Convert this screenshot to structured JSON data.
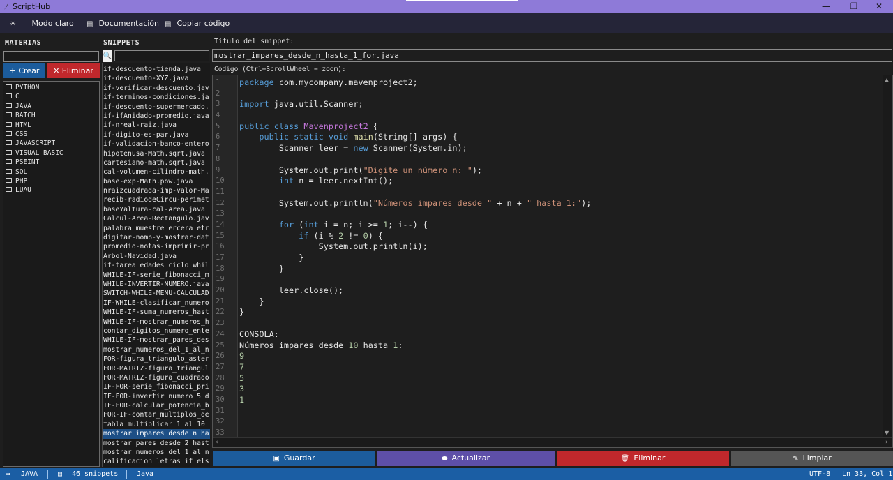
{
  "window": {
    "title": "ScriptHub",
    "controls": [
      "—",
      "❐",
      "✕"
    ]
  },
  "menu": [
    {
      "icon": "☀",
      "label": "Modo claro"
    },
    {
      "icon": "▤",
      "label": "Documentación"
    },
    {
      "icon": "▤",
      "label": "Copiar código"
    }
  ],
  "materias": {
    "title": "MATERIAS",
    "create_label": "+ Crear",
    "delete_label": "✕ Eliminar",
    "items": [
      "PYTHON",
      "C",
      "JAVA",
      "BATCH",
      "HTML",
      "CSS",
      "JAVASCRIPT",
      "VISUAL BASIC",
      "PSEINT",
      "SQL",
      "PHP",
      "LUAU"
    ]
  },
  "snippets": {
    "title": "SNIPPETS",
    "search_icon": "🔍",
    "selected_index": 39,
    "items": [
      "if-descuento-tienda.java",
      "if-descuento-XYZ.java",
      "if-verificar-descuento.jav",
      "if-terminos-condiciones.ja",
      "if-descuento-supermercado.",
      "if-ifAnidado-promedio.java",
      "if-nreal-raiz.java",
      "if-digito-es-par.java",
      "if-validacion-banco-entero",
      "hipotenusa-Math.sqrt.java",
      "cartesiano-math.sqrt.java",
      "cal-volumen-cilindro-math.",
      "base-exp-Math.pow.java",
      "nraizcuadrada-imp-valor-Ma",
      "recib-radiodeCircu-perimet",
      "baseYaltura-cal-Area.java",
      "Calcul-Area-Rectangulo.jav",
      "palabra_muestre_ercera_etr",
      "digitar-nomb-y-mostrar-dat",
      "promedio-notas-imprimir-pr",
      "Arbol-Navidad.java",
      "if-tarea_edades_ciclo_whil",
      "WHILE-IF-serie_fibonacci_m",
      "WHILE-INVERTIR-NUMERO.java",
      "SWITCH-WHILE-MENU-CALCULAD",
      "IF-WHILE-clasificar_numero",
      "WHILE-IF-suma_numeros_hast",
      "WHILE-IF-mostrar_numeros_h",
      "contar_digitos_numero_ente",
      "WHILE-IF-mostrar_pares_des",
      "mostrar_numeros_del_1_al_n",
      "FOR-figura_triangulo_aster",
      "FOR-MATRIZ-figura_triangul",
      "FOR-MATRIZ-figura_cuadrado",
      "IF-FOR-serie_fibonacci_pri",
      "IF-FOR-invertir_numero_5_d",
      "IF-FOR-calcular_potencia_b",
      "FOR-IF-contar_multiplos_de",
      "tabla_multiplicar_1_al_10_",
      "mostrar_impares_desde_n_ha",
      "mostrar_pares_desde_2_hast",
      "mostrar_numeros_del_1_al_n",
      "calificacion_letras_if_els"
    ]
  },
  "editor": {
    "title_label": "Título del snippet:",
    "title_value": "mostrar_impares_desde_n_hasta_1_for.java",
    "code_label": "Código  (Ctrl+ScrollWheel = zoom):",
    "line_numbers": [
      "1",
      "2",
      "3",
      "4",
      "5",
      "6",
      "7",
      "8",
      "9",
      "10",
      "11",
      "12",
      "13",
      "14",
      "15",
      "16",
      "17",
      "18",
      "19",
      "20",
      "21",
      "22",
      "23",
      "24",
      "25",
      "26",
      "27",
      "28",
      "29",
      "30",
      "31",
      "32",
      "33"
    ],
    "code": {
      "l1_kw": "package",
      "l1_rest": " com.mycompany.mavenproject2;",
      "l3_kw": "import",
      "l3_rest": " java.util.Scanner;",
      "l5_kw1": "public",
      "l5_kw2": " class",
      "l5_cls": " Mavenproject2",
      "l5_rest": " {",
      "l6_ind": "    ",
      "l6_kw1": "public",
      "l6_kw2": " static",
      "l6_kw3": " void",
      "l6_fn": " main",
      "l6_rest": "(String[] args) {",
      "l7_a": "        Scanner leer = ",
      "l7_kw": "new",
      "l7_b": " Scanner(System.in);",
      "l9_a": "        System.out.print(",
      "l9_str": "\"Digite un número n: \"",
      "l9_b": ");",
      "l10_ind": "        ",
      "l10_kw": "int",
      "l10_b": " n = leer.nextInt();",
      "l12_a": "        System.out.println(",
      "l12_str1": "\"Números impares desde \"",
      "l12_b": " + n + ",
      "l12_str2": "\" hasta 1:\"",
      "l12_c": ");",
      "l14_ind": "        ",
      "l14_kw": "for",
      "l14_a": " (",
      "l14_kw2": "int",
      "l14_b": " i = n; i >= ",
      "l14_n1": "1",
      "l14_c": "; i--) {",
      "l15_ind": "            ",
      "l15_kw": "if",
      "l15_a": " (i % ",
      "l15_n1": "2",
      "l15_b": " != ",
      "l15_n2": "0",
      "l15_c": ") {",
      "l16": "                System.out.println(i);",
      "l17": "            }",
      "l18": "        }",
      "l20": "        leer.close();",
      "l21": "    }",
      "l22": "}",
      "l24": "CONSOLA:",
      "l25_a": "Números impares desde ",
      "l25_n": "10",
      "l25_b": " hasta ",
      "l25_n2": "1",
      "l25_c": ":",
      "l26": "9",
      "l27": "7",
      "l28": "5",
      "l29": "3",
      "l30": "1"
    }
  },
  "actions": {
    "save": {
      "icon": "▣",
      "label": "Guardar"
    },
    "update": {
      "icon": "⬬",
      "label": "Actualizar"
    },
    "delete": {
      "icon": "🗑",
      "label": "Eliminar"
    },
    "clear": {
      "icon": "✎",
      "label": "Limpiar"
    }
  },
  "status": {
    "category": "JAVA",
    "count": "46 snippets",
    "language": "Java",
    "encoding": "UTF-8",
    "position": "Ln 33, Col 1"
  },
  "colors": {
    "accent_blue": "#1c5c9c",
    "accent_purple": "#5e4fa8",
    "accent_red": "#c0282c",
    "titlebar": "#8e7ad8",
    "statusbar": "#1b5ea4"
  }
}
